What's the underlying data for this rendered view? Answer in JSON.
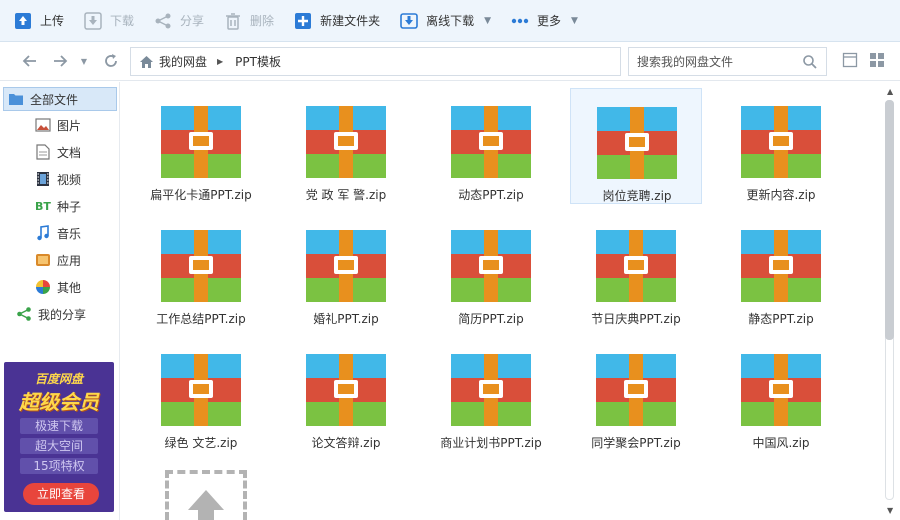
{
  "toolbar": {
    "upload": "上传",
    "download": "下载",
    "share": "分享",
    "delete": "删除",
    "new_folder": "新建文件夹",
    "offline_download": "离线下载",
    "more": "更多"
  },
  "address": {
    "crumbs": [
      "我的网盘",
      "PPT模板"
    ],
    "search_placeholder": "搜索我的网盘文件"
  },
  "sidebar": {
    "items": [
      {
        "label": "全部文件",
        "icon": "folder-icon",
        "active": true
      },
      {
        "label": "图片",
        "icon": "picture-icon"
      },
      {
        "label": "文档",
        "icon": "document-icon"
      },
      {
        "label": "视频",
        "icon": "video-icon"
      },
      {
        "label": "种子",
        "icon": "bt-icon"
      },
      {
        "label": "音乐",
        "icon": "music-icon"
      },
      {
        "label": "应用",
        "icon": "app-icon"
      },
      {
        "label": "其他",
        "icon": "other-icon"
      },
      {
        "label": "我的分享",
        "icon": "share-icon"
      }
    ]
  },
  "promo": {
    "brand": "百度网盘",
    "title": "超级会员",
    "features": [
      "极速下载",
      "超大空间",
      "15项特权"
    ],
    "cta": "立即查看"
  },
  "files": [
    {
      "name": "扁平化卡通PPT.zip"
    },
    {
      "name": "党 政 军 警.zip"
    },
    {
      "name": "动态PPT.zip"
    },
    {
      "name": "岗位竞聘.zip",
      "selected": true
    },
    {
      "name": "更新内容.zip"
    },
    {
      "name": "工作总结PPT.zip"
    },
    {
      "name": "婚礼PPT.zip"
    },
    {
      "name": "简历PPT.zip"
    },
    {
      "name": "节日庆典PPT.zip"
    },
    {
      "name": "静态PPT.zip"
    },
    {
      "name": "绿色 文艺.zip"
    },
    {
      "name": "论文答辩.zip"
    },
    {
      "name": "商业计划书PPT.zip"
    },
    {
      "name": "同学聚会PPT.zip"
    },
    {
      "name": "中国风.zip"
    }
  ],
  "colors": {
    "zip_blue": "#41b8e8",
    "zip_red": "#d94f3a",
    "zip_green": "#7bc242",
    "zip_strap": "#e8901e",
    "accent": "#2c7bd6"
  }
}
